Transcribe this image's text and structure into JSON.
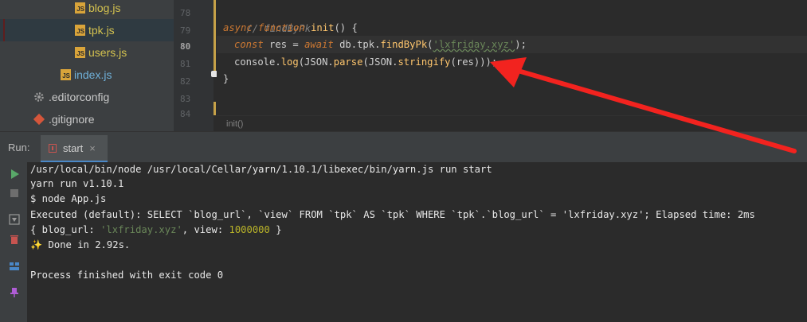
{
  "project_tree": {
    "items": [
      {
        "label": "blog.js",
        "icon": "js-file-icon"
      },
      {
        "label": "tpk.js",
        "icon": "js-file-icon",
        "selected": true
      },
      {
        "label": "users.js",
        "icon": "js-file-icon"
      },
      {
        "label": "index.js",
        "icon": "js-file-icon"
      },
      {
        "label": ".editorconfig",
        "icon": "gear-icon"
      },
      {
        "label": ".gitignore",
        "icon": "git-icon"
      }
    ]
  },
  "editor": {
    "line_numbers": [
      "78",
      "79",
      "80",
      "81",
      "82",
      "83",
      "84"
    ],
    "current_line": "80",
    "code": {
      "line78_comment": "// findByPk",
      "line79_kw": "async function",
      "line79_fn": "init",
      "line79_rest": "() {",
      "line80_kw1": "const",
      "line80_mid": " res = ",
      "line80_kw2": "await",
      "line80_obj": " db.tpk.",
      "line80_fn": "findByPk",
      "line80_open": "(",
      "line80_str": "'lxfriday.xyz'",
      "line80_close": ");",
      "line81_a": "console.",
      "line81_fn1": "log",
      "line81_b": "(JSON.",
      "line81_fn2": "parse",
      "line81_c": "(JSON.",
      "line81_fn3": "stringify",
      "line81_d": "(res)));",
      "line82": "}"
    },
    "breadcrumb": "init()"
  },
  "run_panel": {
    "label": "Run:",
    "tab_label": "start",
    "tab_close": "×",
    "console": {
      "line1": "/usr/local/bin/node /usr/local/Cellar/yarn/1.10.1/libexec/bin/yarn.js run start",
      "line2": "yarn run v1.10.1",
      "line3": "$ node App.js",
      "line4": "Executed (default): SELECT `blog_url`, `view` FROM `tpk` AS `tpk` WHERE `tpk`.`blog_url` = 'lxfriday.xyz'; Elapsed time: 2ms",
      "line5_a": "{ blog_url: ",
      "line5_str": "'lxfriday.xyz'",
      "line5_b": ", view: ",
      "line5_num": "1000000",
      "line5_c": " }",
      "line6_icon": "✨",
      "line6_text": " Done in 2.92s.",
      "line8": "Process finished with exit code 0"
    },
    "toolbar": [
      "run-icon",
      "stop-icon",
      "scroll-to-end-icon",
      "delete-icon",
      "layout-icon",
      "pin-icon"
    ]
  },
  "colors": {
    "arrow": "#f2231f",
    "fold_bar": "#c6a148"
  }
}
